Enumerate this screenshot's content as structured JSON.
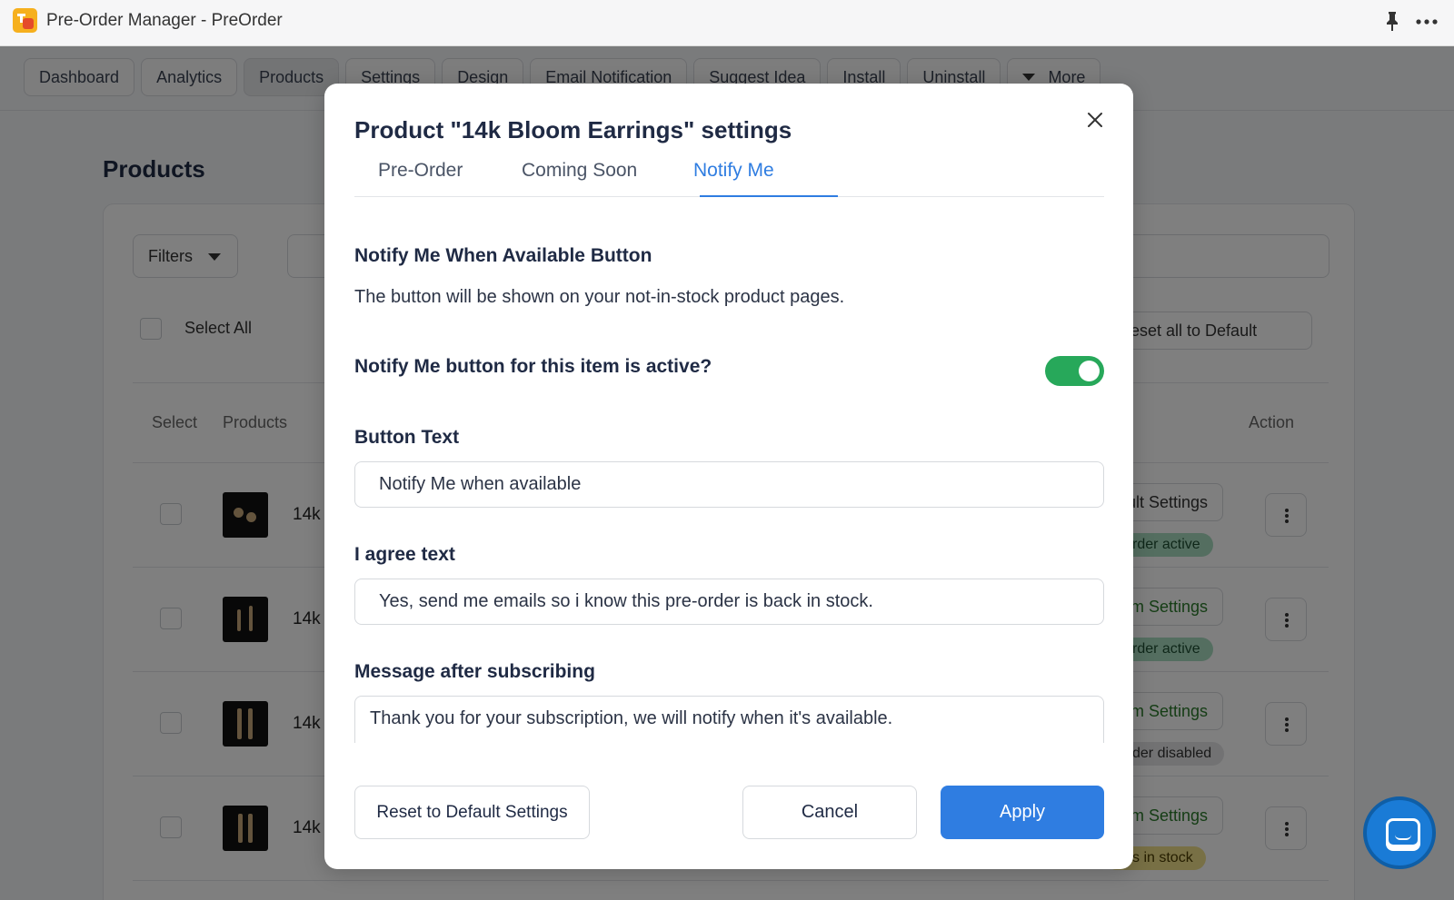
{
  "window": {
    "title": "Pre-Order Manager - PreOrder"
  },
  "nav": {
    "tabs": [
      {
        "label": "Dashboard"
      },
      {
        "label": "Analytics"
      },
      {
        "label": "Products",
        "active": true
      },
      {
        "label": "Settings"
      },
      {
        "label": "Design"
      },
      {
        "label": "Email Notification"
      },
      {
        "label": "Suggest Idea"
      },
      {
        "label": "Install"
      },
      {
        "label": "Uninstall"
      },
      {
        "label": "More"
      }
    ]
  },
  "products_page": {
    "title": "Products",
    "filters_label": "Filters",
    "select_all_label": "Select All",
    "reset_all_label": "Reset all to Default",
    "columns": {
      "select": "Select",
      "products": "Products",
      "action": "Action"
    },
    "rows": [
      {
        "name": "14k",
        "settings": "ult Settings",
        "badge": "rder active",
        "badge_state": "active"
      },
      {
        "name": "14k",
        "settings": "om Settings",
        "badge": "rder active",
        "badge_state": "active"
      },
      {
        "name": "14k",
        "settings": "om Settings",
        "badge": "der disabled",
        "badge_state": "disabled"
      },
      {
        "name": "14k",
        "settings": "om Settings",
        "badge": "s in stock",
        "badge_state": "stock"
      }
    ]
  },
  "modal": {
    "title": "Product \"14k Bloom Earrings\" settings",
    "tabs": [
      {
        "label": "Pre-Order"
      },
      {
        "label": "Coming Soon"
      },
      {
        "label": "Notify Me",
        "active": true
      }
    ],
    "section_heading": "Notify Me When Available Button",
    "section_description": "The button will be shown on your not-in-stock product pages.",
    "toggle_label": "Notify Me button for this item is active?",
    "toggle_on": true,
    "fields": {
      "button_text": {
        "label": "Button Text",
        "value": "Notify Me when available"
      },
      "agree_text": {
        "label": "I agree text",
        "value": "Yes, send me emails so i know this pre-order is back in stock."
      },
      "message_after": {
        "label": "Message after subscribing",
        "value": "Thank you for your subscription, we will notify when it's available."
      }
    },
    "buttons": {
      "reset": "Reset to Default Settings",
      "cancel": "Cancel",
      "apply": "Apply"
    }
  },
  "colors": {
    "accent": "#2f7de1",
    "toggle_on": "#27a85a",
    "chat": "#1a7bd6"
  }
}
